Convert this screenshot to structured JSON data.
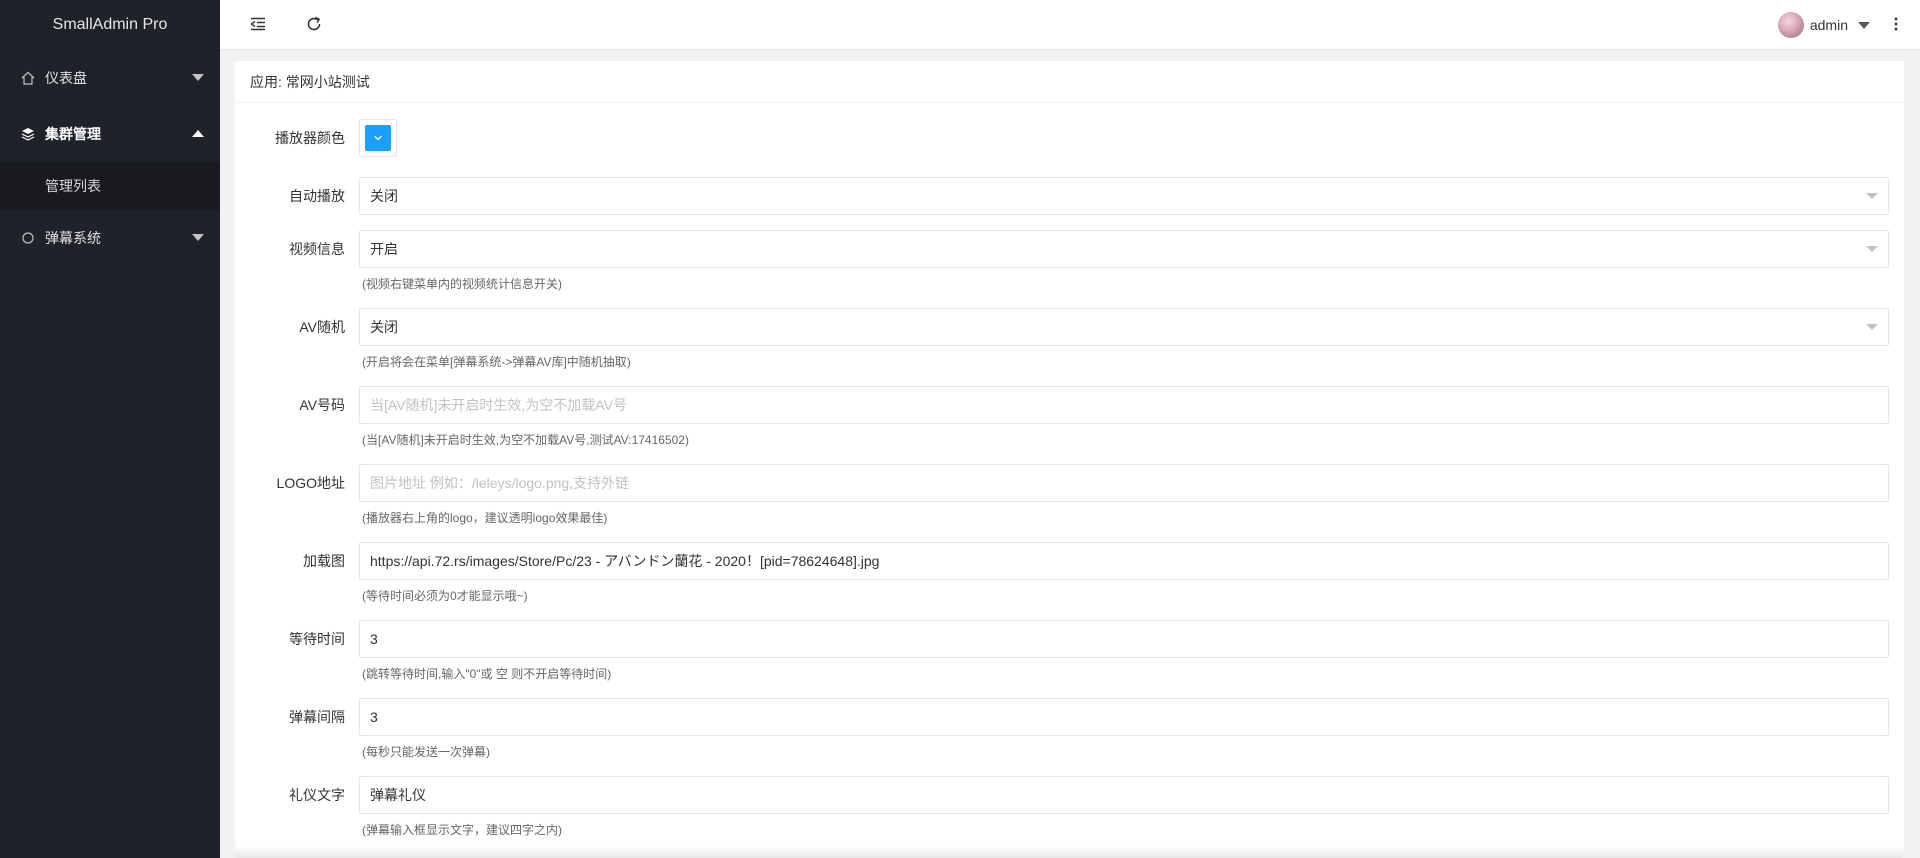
{
  "app": {
    "brand": "SmallAdmin Pro"
  },
  "sidebar": {
    "items": [
      {
        "label": "仪表盘",
        "icon": "home-icon",
        "expanded": false
      },
      {
        "label": "集群管理",
        "icon": "layers-icon",
        "expanded": true,
        "children": [
          {
            "label": "管理列表"
          }
        ]
      },
      {
        "label": "弹幕系统",
        "icon": "circle-icon",
        "expanded": false
      }
    ]
  },
  "header": {
    "user_name": "admin",
    "icons": [
      "indent-icon",
      "refresh-icon",
      "more-vertical-icon"
    ]
  },
  "card": {
    "title": "应用: 常网小站测试"
  },
  "form": {
    "player_color": {
      "label": "播放器颜色",
      "color": "#1e9fff"
    },
    "autoplay": {
      "label": "自动播放",
      "value": "关闭"
    },
    "video_info": {
      "label": "视频信息",
      "value": "开启",
      "hint": "(视频右键菜单内的视频统计信息开关)"
    },
    "av_random": {
      "label": "AV随机",
      "value": "关闭",
      "hint": "(开启将会在菜单[弹幕系统->弹幕AV库]中随机抽取)"
    },
    "av_number": {
      "label": "AV号码",
      "value": "",
      "placeholder": "当[AV随机]未开启时生效,为空不加载AV号",
      "hint": "(当[AV随机]未开启时生效,为空不加载AV号,测试AV:17416502)"
    },
    "logo_url": {
      "label": "LOGO地址",
      "value": "",
      "placeholder": "图片地址 例如：/leleys/logo.png,支持外链",
      "hint": "(播放器右上角的logo，建议透明logo效果最佳)"
    },
    "loading_image": {
      "label": "加载图",
      "value": "https://api.72.rs/images/Store/Pc/23 - アバンドン蘭花 - 2020！[pid=78624648].jpg",
      "hint": "(等待时间必须为0才能显示哦~)"
    },
    "wait_time": {
      "label": "等待时间",
      "value": "3",
      "hint": "(跳转等待时间,输入\"0\"或 空 则不开启等待时间)"
    },
    "danmaku_interval": {
      "label": "弹幕间隔",
      "value": "3",
      "hint": "(每秒只能发送一次弹幕)"
    },
    "etiquette_text": {
      "label": "礼仪文字",
      "value": "弹幕礼仪",
      "hint": "(弹幕输入框显示文字，建议四字之内)"
    }
  },
  "colors": {
    "sidebar_bg": "#20222a",
    "accent": "#1e9fff"
  }
}
